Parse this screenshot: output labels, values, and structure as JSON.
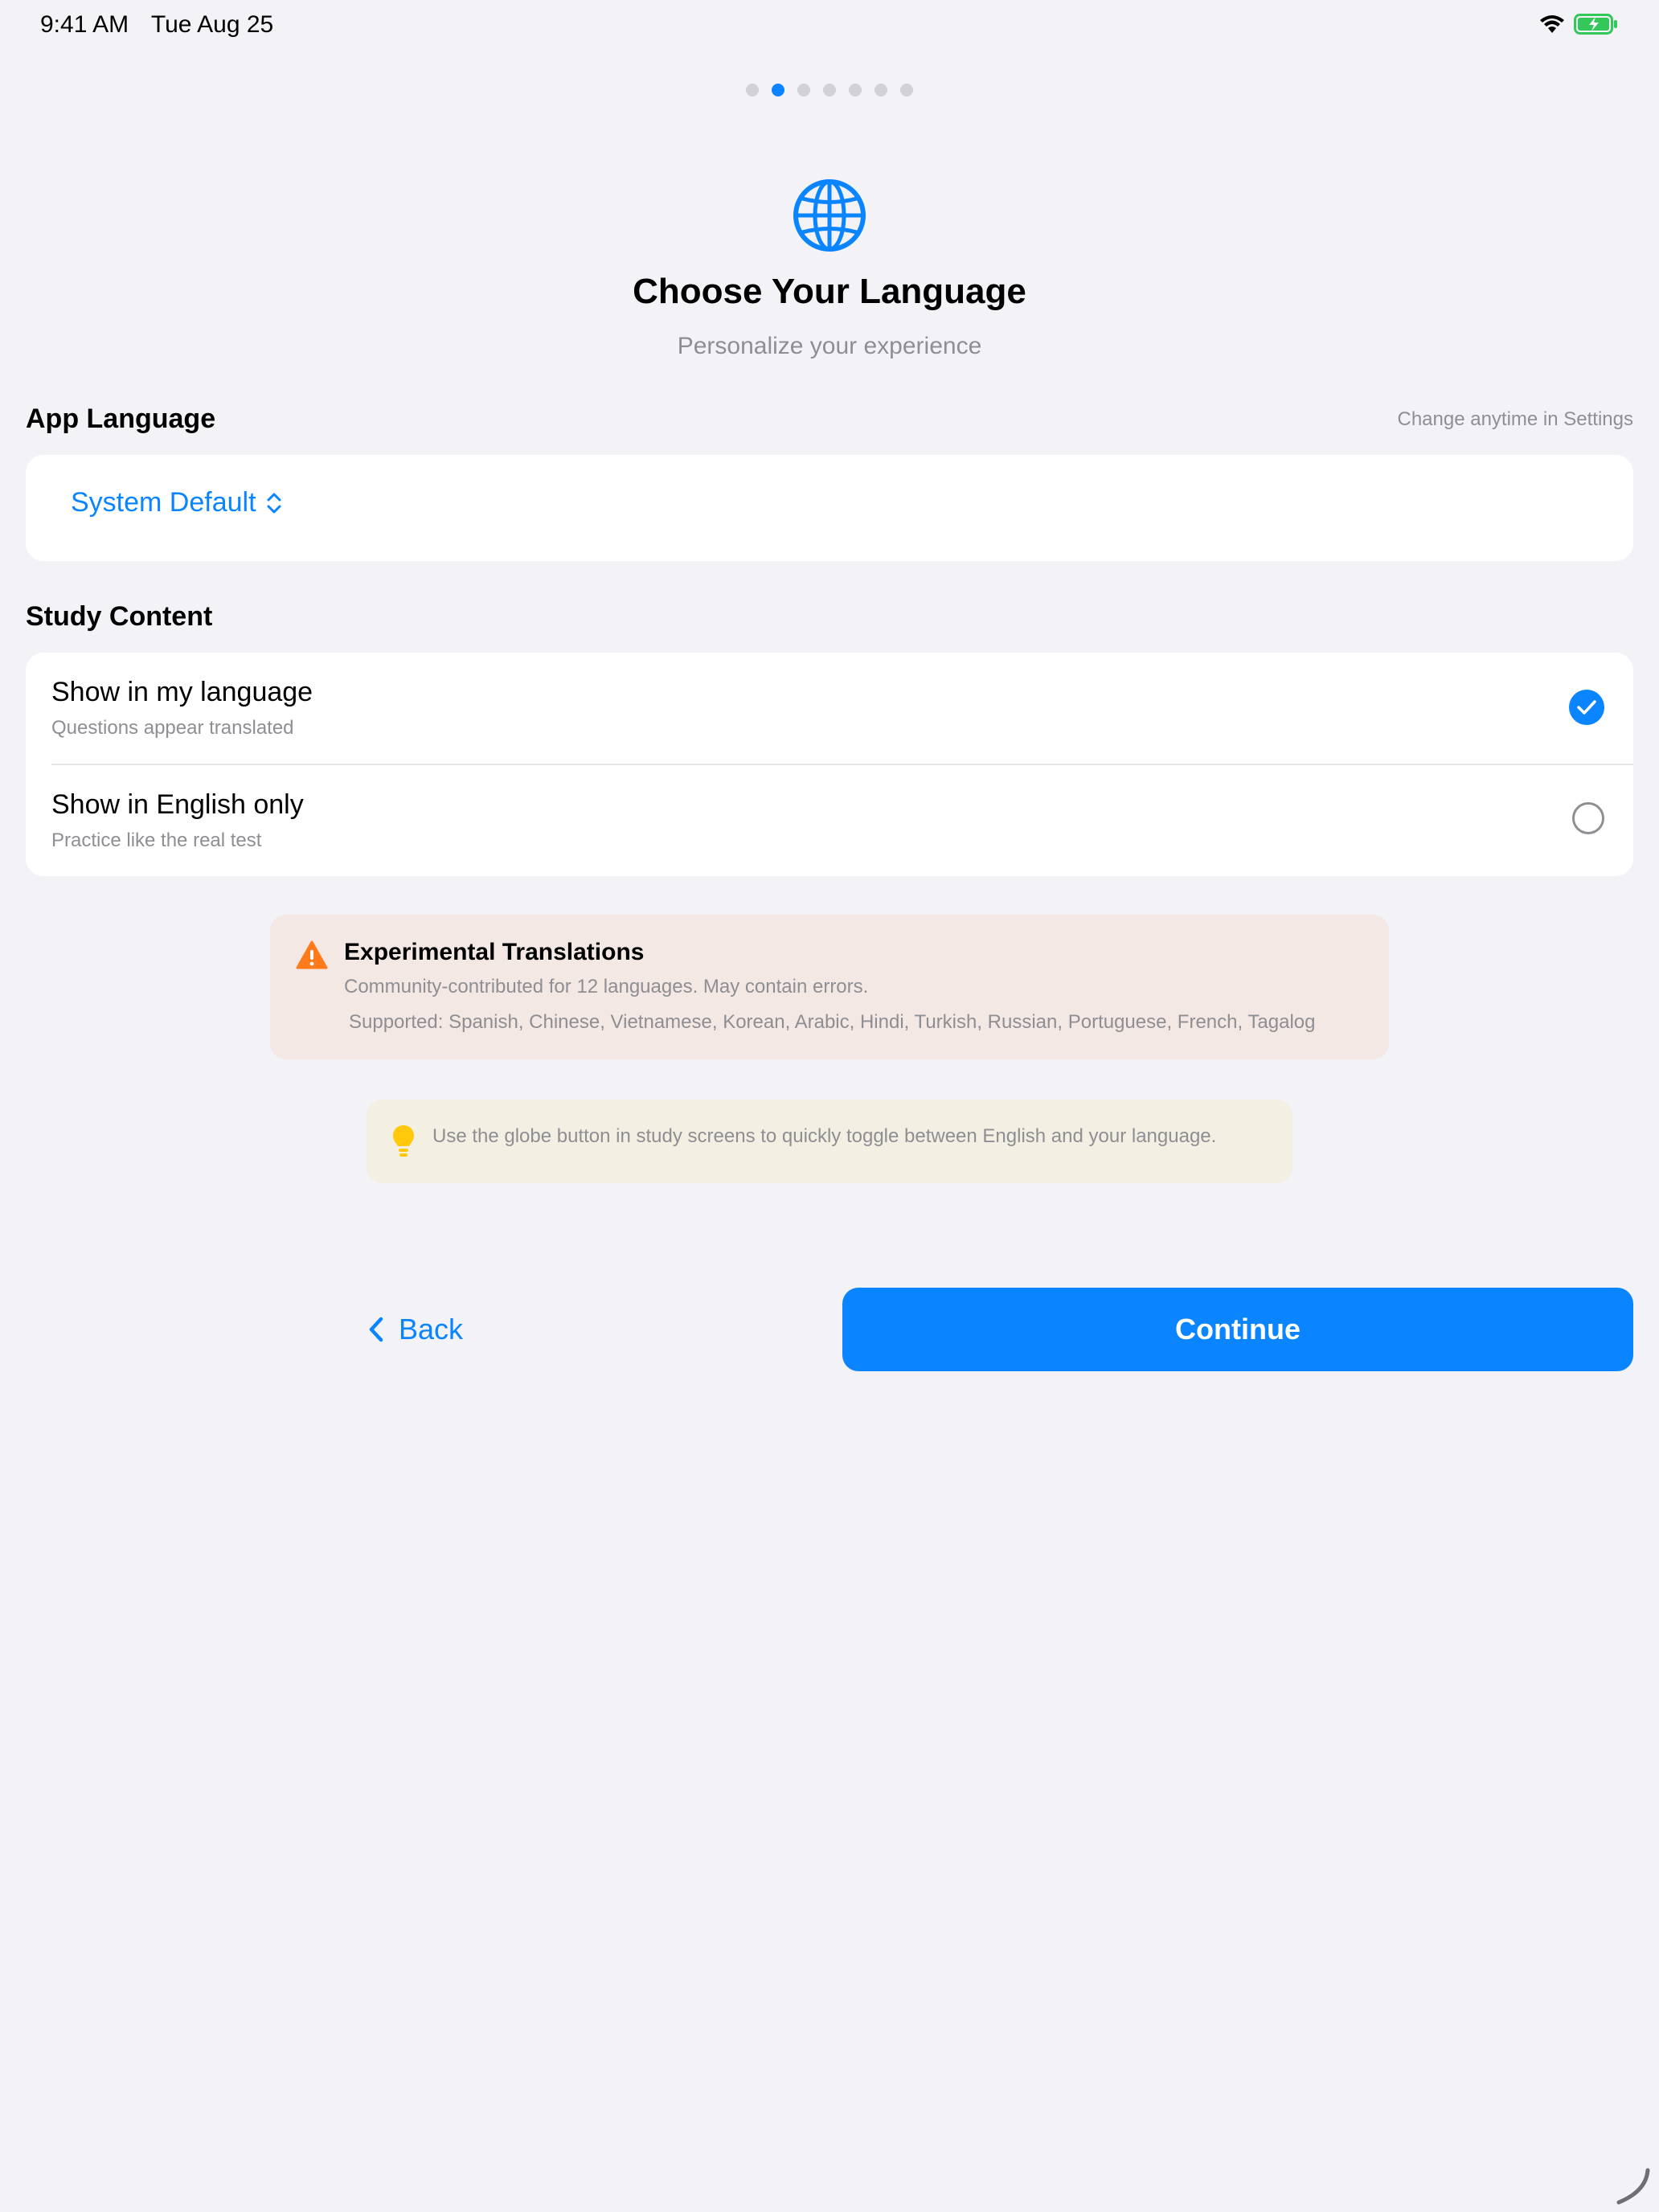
{
  "status_bar": {
    "time": "9:41 AM",
    "date": "Tue Aug 25"
  },
  "pager": {
    "total": 7,
    "active_index": 1
  },
  "header": {
    "icon": "globe-icon",
    "title": "Choose Your Language",
    "subtitle": "Personalize your experience"
  },
  "app_language": {
    "label": "App Language",
    "note": "Change anytime in Settings",
    "selected": "System Default"
  },
  "study_content": {
    "label": "Study Content",
    "options": [
      {
        "title": "Show in my language",
        "subtitle": "Questions appear translated",
        "selected": true
      },
      {
        "title": "Show in English only",
        "subtitle": "Practice like the real test",
        "selected": false
      }
    ]
  },
  "warning": {
    "title": "Experimental Translations",
    "body": "Community-contributed for 12 languages. May contain errors.",
    "supported": "Supported: Spanish, Chinese, Vietnamese, Korean, Arabic, Hindi, Turkish, Russian, Portuguese, French, Tagalog",
    "color": "#ff7a1a"
  },
  "tip": {
    "text": "Use the globe button in study screens to quickly toggle between English and your language.",
    "color": "#ffc80a"
  },
  "buttons": {
    "back": "Back",
    "continue": "Continue"
  },
  "colors": {
    "accent": "#0a84ff",
    "background": "#f2f2f7",
    "battery": "#34c759"
  }
}
